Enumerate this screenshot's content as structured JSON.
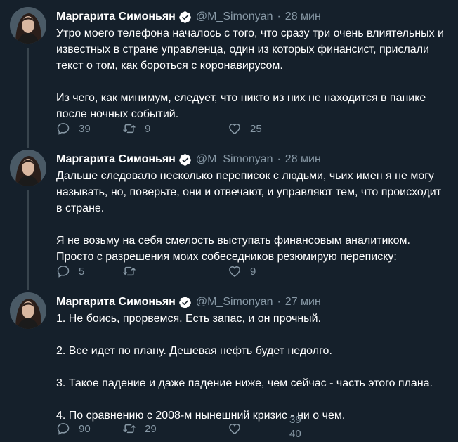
{
  "tweets": [
    {
      "name": "Маргарита Симоньян",
      "handle": "@M_Simonyan",
      "time": "28 мин",
      "paragraphs": [
        "Утро моего телефона началось с того, что сразу три очень влиятельных и известных в стране управленца, один из которых финансист, прислали текст о том, как бороться с коронавирусом.",
        "Из чего, как минимум, следует, что никто из них не находится в панике после ночных событий."
      ],
      "replies": "39",
      "retweets": "9",
      "likes": "25"
    },
    {
      "name": "Маргарита Симоньян",
      "handle": "@M_Simonyan",
      "time": "28 мин",
      "paragraphs": [
        "Дальше следовало несколько переписок с людьми, чьих имен я не могу называть, но, поверьте, они и отвечают, и управляют тем, что происходит в стране.",
        "Я не возьму на себя смелость выступать финансовым аналитиком. Просто с разрешения моих собеседников резюмирую переписку:"
      ],
      "replies": "5",
      "retweets": "",
      "likes": "9"
    },
    {
      "name": "Маргарита Симоньян",
      "handle": "@M_Simonyan",
      "time": "27 мин",
      "paragraphs": [
        "1. Не боись, прорвемся. Есть запас, и он прочный.",
        "2. Все идет по плану. Дешевая нефть будет недолго.",
        "3. Такое падение и даже падение ниже, чем сейчас - часть этого плана.",
        "4. По сравнению с 2008-м нынешний кризис - ни о чем."
      ],
      "replies": "90",
      "retweets": "29",
      "likes_old": "39",
      "likes_new": "40"
    }
  ],
  "separator": "·",
  "icons": {
    "reply": "reply-icon",
    "retweet": "retweet-icon",
    "like": "heart-icon",
    "verified": "verified-badge-icon"
  },
  "colors": {
    "background": "#15202b",
    "text": "#ffffff",
    "muted": "#8899a6",
    "verified": "#ffffff",
    "thread_line": "#38444d"
  }
}
